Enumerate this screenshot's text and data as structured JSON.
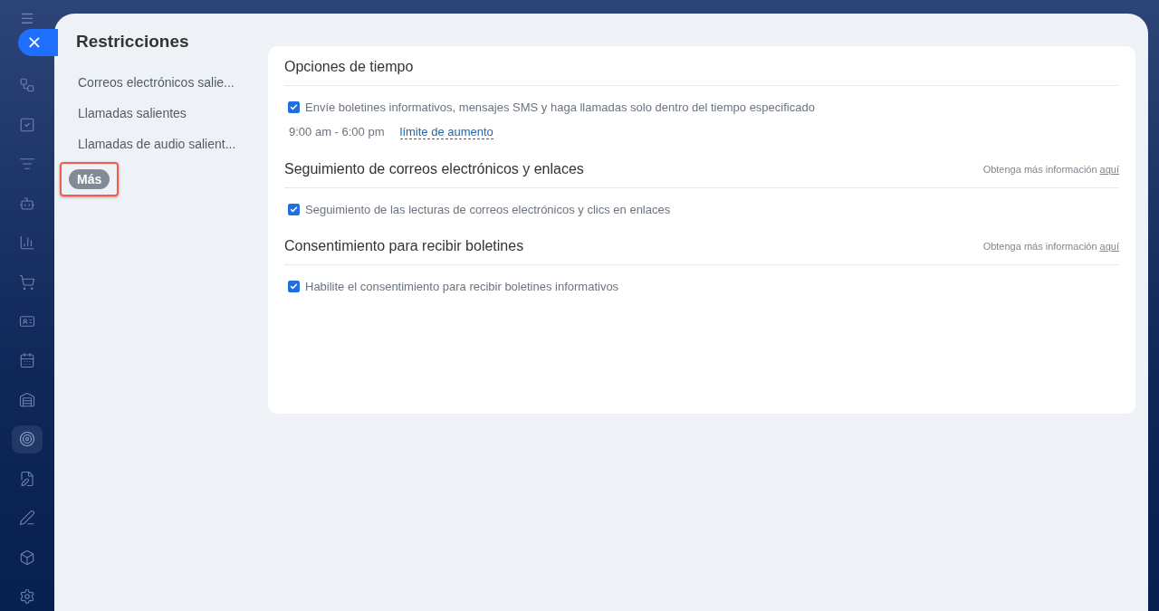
{
  "sidebar": {
    "items": [
      {
        "selected": false
      },
      {
        "selected": false
      },
      {
        "selected": false
      },
      {
        "selected": false
      },
      {
        "selected": false
      },
      {
        "selected": false
      },
      {
        "selected": false
      },
      {
        "selected": false
      },
      {
        "selected": false
      },
      {
        "selected": true
      },
      {
        "selected": false
      },
      {
        "selected": false
      },
      {
        "selected": false
      },
      {
        "selected": false
      }
    ]
  },
  "close_button": {
    "label": "×"
  },
  "panel": {
    "title": "Restricciones",
    "nav_items": [
      {
        "label": "Correos electrónicos salie..."
      },
      {
        "label": "Llamadas salientes"
      },
      {
        "label": "Llamadas de audio salient..."
      }
    ],
    "more_button": {
      "label": "Más",
      "highlighted": true
    },
    "sections": [
      {
        "title": "Opciones de tiempo",
        "options": [
          {
            "label": "Envíe boletines informativos, mensajes SMS y haga llamadas solo dentro del tiempo especificado",
            "checked": true
          }
        ],
        "time_range": "9:00 am - 6:00 pm",
        "time_link": "límite de aumento"
      },
      {
        "title": "Seguimiento de correos electrónicos y enlaces",
        "info": "Obtenga más información",
        "info_link": "aquí",
        "options": [
          {
            "label": "Seguimiento de las lecturas de correos electrónicos y clics en enlaces",
            "checked": true
          }
        ]
      },
      {
        "title": "Consentimiento para recibir boletines",
        "info": "Obtenga más información",
        "info_link": "aquí",
        "options": [
          {
            "label": "Habilite el consentimiento para recibir boletines informativos",
            "checked": true
          }
        ]
      }
    ]
  }
}
